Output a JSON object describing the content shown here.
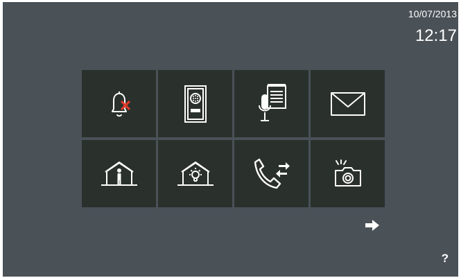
{
  "status": {
    "date": "10/07/2013",
    "time": "12:17"
  },
  "menu": {
    "tiles": [
      {
        "icon": "bell-muted-icon"
      },
      {
        "icon": "door-panel-icon"
      },
      {
        "icon": "voice-memo-icon"
      },
      {
        "icon": "envelope-icon"
      },
      {
        "icon": "house-person-icon"
      },
      {
        "icon": "house-light-icon"
      },
      {
        "icon": "call-transfer-icon"
      },
      {
        "icon": "camera-flash-icon"
      }
    ]
  },
  "navigation": {
    "next_icon": "arrow-right-icon",
    "help_label": "?"
  },
  "colors": {
    "background": "#4a5157",
    "tile": "#2a302c",
    "icon": "#ffffff",
    "mute_mark": "#e03a2a"
  }
}
